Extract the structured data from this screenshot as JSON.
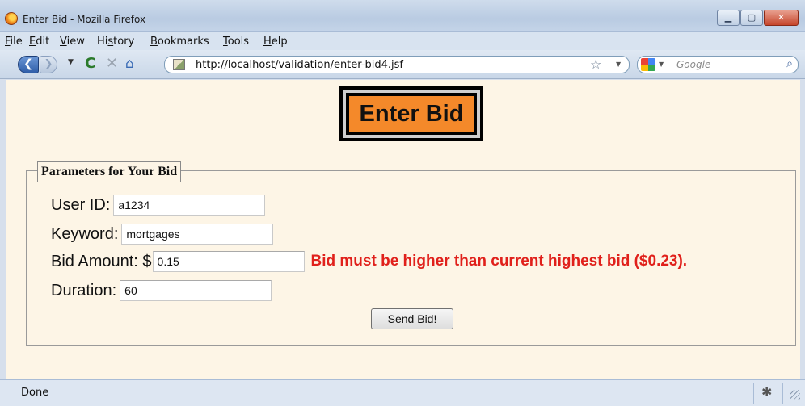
{
  "window": {
    "title": "Enter Bid - Mozilla Firefox",
    "minimize_glyph": "▁",
    "maximize_glyph": "▢",
    "close_glyph": "✕"
  },
  "menu": {
    "items": [
      {
        "key": "F",
        "rest": "ile"
      },
      {
        "key": "E",
        "rest": "dit"
      },
      {
        "key": "V",
        "rest": "iew"
      },
      {
        "pre": "Hi",
        "key": "s",
        "rest": "tory"
      },
      {
        "key": "B",
        "rest": "ookmarks"
      },
      {
        "key": "T",
        "rest": "ools"
      },
      {
        "key": "H",
        "rest": "elp"
      }
    ]
  },
  "nav": {
    "back_glyph": "❮",
    "forward_glyph": "❯",
    "dropdown_glyph": "▼",
    "reload_glyph": "C",
    "stop_glyph": "✕",
    "home_glyph": "⌂",
    "url": "http://localhost/validation/enter-bid4.jsf",
    "star_glyph": "☆",
    "search_engine": "Google",
    "search_glyph": "⌕"
  },
  "page": {
    "heading": "Enter Bid",
    "legend": "Parameters for Your Bid",
    "fields": {
      "user_id": {
        "label": "User ID:",
        "value": "a1234"
      },
      "keyword": {
        "label": "Keyword:",
        "value": "mortgages"
      },
      "bid_amount": {
        "label": "Bid Amount: $",
        "value": "0.15",
        "error": "Bid must be higher than current highest bid ($0.23)."
      },
      "duration": {
        "label": "Duration:",
        "value": "60"
      }
    },
    "submit_label": "Send Bid!"
  },
  "status": {
    "text": "Done",
    "addon_glyph": "✱"
  },
  "colors": {
    "heading_bg": "#f4892a",
    "error_text": "#e0201b",
    "page_bg": "#fdf5e6"
  }
}
